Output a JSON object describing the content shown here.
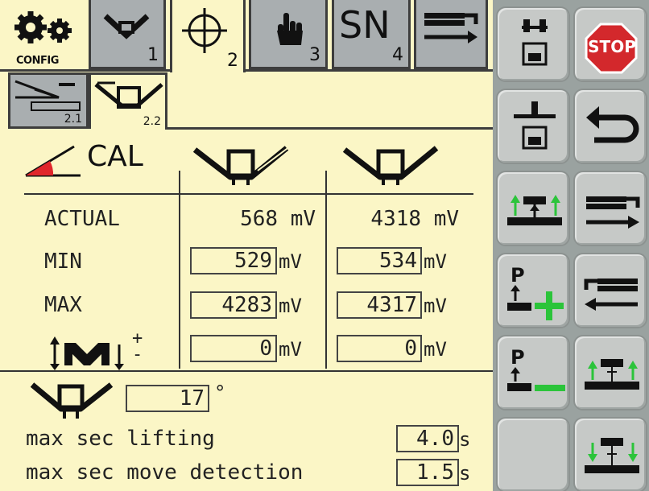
{
  "tabs": {
    "config_label": "CONFIG",
    "tab1_num": "1",
    "tab2_num": "2",
    "tab3_num": "3",
    "tab4_label": "SN",
    "tab4_num": "4"
  },
  "subtabs": {
    "sub1_num": "2.1",
    "sub2_num": "2.2"
  },
  "calibration": {
    "title": "CAL",
    "rows": {
      "actual": {
        "label": "ACTUAL",
        "left": "568 mV",
        "right": "4318 mV"
      },
      "min": {
        "label": "MIN",
        "left": "529",
        "right": "534"
      },
      "max": {
        "label": "MAX",
        "left": "4283",
        "right": "4317"
      },
      "offset": {
        "plus": "+",
        "minus": "-",
        "left": "0",
        "right": "0"
      }
    },
    "unit_mv": "mV",
    "angle_value": "17",
    "angle_unit": "°",
    "lifting_label": "max sec lifting",
    "lifting_value": "4.0",
    "move_label": "max sec move detection",
    "move_value": "1.5",
    "unit_s": "s"
  },
  "sidebar": {
    "stop_label": "STOP",
    "p_label": "P"
  },
  "colors": {
    "panel_bg": "#fbf6c6",
    "tab_bg": "#a9aeb0",
    "button_bg": "#c6c9c7",
    "stop_red": "#d3282c",
    "accent_green": "#2bc43a"
  }
}
